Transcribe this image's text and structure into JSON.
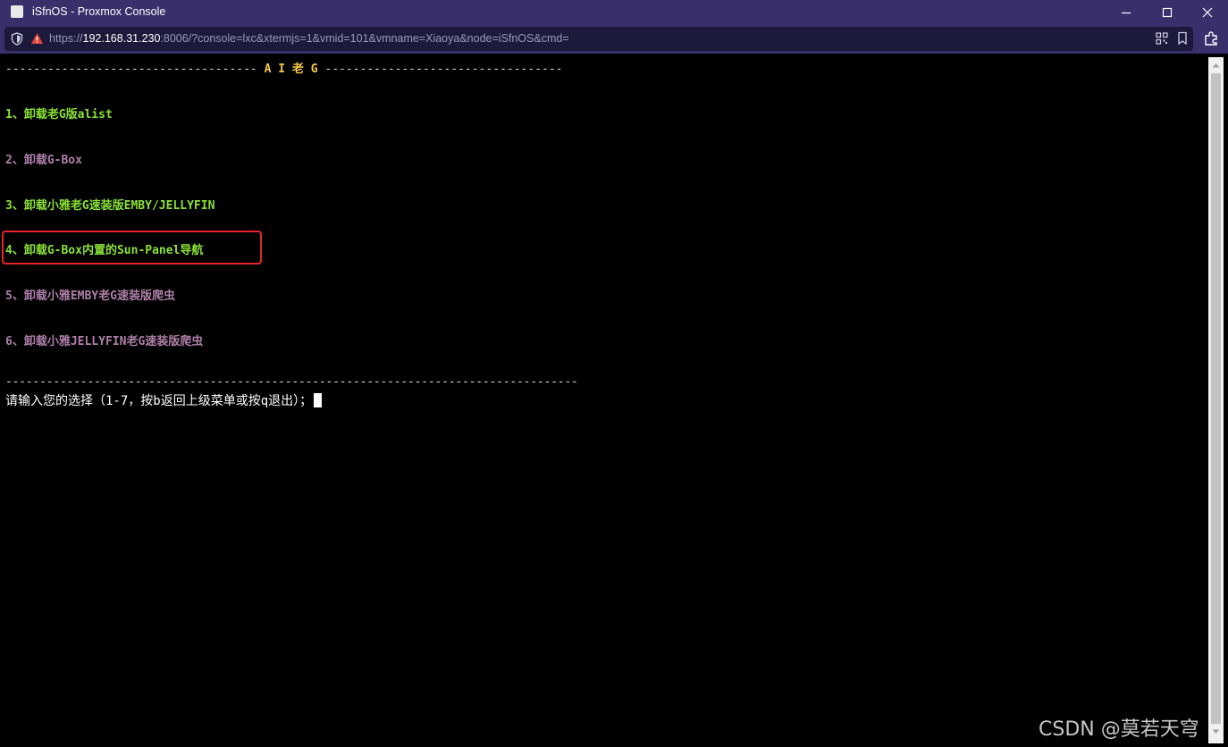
{
  "window": {
    "title": "iSfnOS - Proxmox Console"
  },
  "address_bar": {
    "url_scheme": "https://",
    "url_host": "192.168.31.230",
    "url_rest": ":8006/?console=lxc&xtermjs=1&vmid=101&vmname=Xiaoya&node=iSfnOS&cmd="
  },
  "terminal": {
    "header_left": "------------------------------------",
    "header_title": "A I 老 G",
    "header_right": "----------------------------------",
    "menu": [
      {
        "text": "1、卸载老G版alist",
        "color": "#8ae234"
      },
      {
        "text": "2、卸载G-Box",
        "color": "#ad7fa8"
      },
      {
        "text": "3、卸载小雅老G速装版EMBY/JELLYFIN",
        "color": "#8ae234"
      },
      {
        "text": "4、卸载G-Box内置的Sun-Panel导航",
        "color": "#8ae234"
      },
      {
        "text": "5、卸载小雅EMBY老G速装版爬虫",
        "color": "#ad7fa8"
      },
      {
        "text": "6、卸载小雅JELLYFIN老G速装版爬虫",
        "color": "#ad7fa8"
      }
    ],
    "footer_sep": "------------------------------------------------------------------------------------",
    "prompt": "请输入您的选择（1-7，按b返回上级菜单或按q退出）；"
  },
  "watermark": "CSDN @莫若天穹",
  "colors": {
    "titlebar": "#38306b",
    "highlight_box": "#e8242b",
    "header_accent": "#f5c84b"
  }
}
